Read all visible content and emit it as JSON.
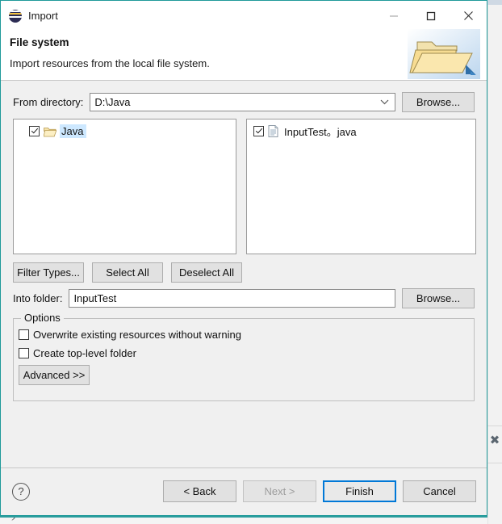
{
  "window": {
    "title": "Import",
    "icon": "eclipse-icon",
    "minimize_label": "–",
    "maximize_label": "☐",
    "close_label": "✕"
  },
  "header": {
    "title": "File system",
    "description": "Import resources from the local file system.",
    "art_icon": "open-folder-icon"
  },
  "from_directory": {
    "label": "From directory:",
    "value": "D:\\Java",
    "dropdown_icon": "chevron-down-icon",
    "browse_label": "Browse..."
  },
  "source_tree": {
    "items": [
      {
        "label": "Java",
        "checked": true,
        "icon": "open-folder-icon",
        "selected": true
      }
    ]
  },
  "file_list": {
    "items": [
      {
        "label": "InputTest。java",
        "checked": true,
        "icon": "file-icon",
        "selected": false
      }
    ]
  },
  "selection_buttons": {
    "filter_types": "Filter Types...",
    "select_all": "Select All",
    "deselect_all": "Deselect All"
  },
  "into_folder": {
    "label": "Into folder:",
    "value": "InputTest",
    "browse_label": "Browse..."
  },
  "options": {
    "group_title": "Options",
    "overwrite": {
      "label": "Overwrite existing resources without warning",
      "checked": false
    },
    "create_top_level": {
      "label": "Create top-level folder",
      "checked": false
    },
    "advanced_label": "Advanced >>"
  },
  "footer": {
    "help_icon": "question-mark-icon",
    "back_label": "< Back",
    "next_label": "Next >",
    "finish_label": "Finish",
    "cancel_label": "Cancel"
  },
  "backdrop": {
    "close_marker": "✖",
    "stray_glyph": ")"
  },
  "colors": {
    "dialog_border": "#1f9a9a",
    "default_button_outline": "#0078d7",
    "tree_selection": "#cde8ff",
    "folder_yellow": "#f5d98b",
    "panel_gray": "#f0f0f0"
  }
}
